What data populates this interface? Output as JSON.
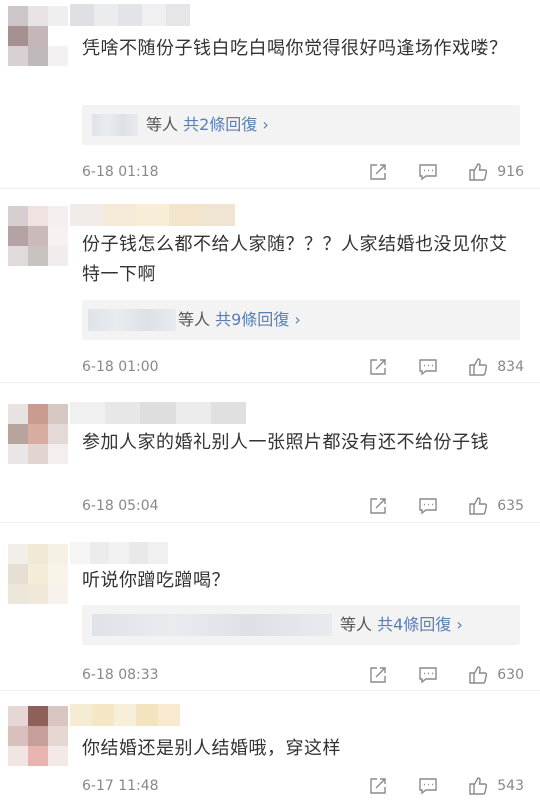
{
  "comments": [
    {
      "text": "凭啥不随份子钱白吃白喝你觉得很好吗逢场作戏喽？",
      "reply": {
        "who": "等人",
        "link": "共2條回復 ›"
      },
      "time": "6-18 01:18",
      "likes": "916",
      "avatar_colors": [
        "#cdc6c8",
        "#e8e4e6",
        "#f0eeef",
        "#a68f8f",
        "#c5b6b8",
        "#ffffff",
        "#d8d0d3",
        "#bfb9bb",
        "#f3f1f2"
      ],
      "name_colors": [
        "#dfe0e4",
        "#ebeced",
        "#e3e4e7",
        "#f0f0f2",
        "#e6e6e9"
      ]
    },
    {
      "text": "份子钱怎么都不给人家随？？？人家结婚也没见你艾特一下啊",
      "reply": {
        "who": "等人",
        "link": "共9條回復 ›"
      },
      "time": "6-18 01:00",
      "likes": "834",
      "avatar_colors": [
        "#d7cfcf",
        "#efe2e1",
        "#f4eeee",
        "#b3a3a4",
        "#cbbab9",
        "#f6f2f1",
        "#e1dada",
        "#c8c2c1",
        "#f2eded"
      ],
      "name_colors": [
        "#f2ece8",
        "#f5e9d8",
        "#f8edd6",
        "#f3e4cc",
        "#f0e5d3"
      ]
    },
    {
      "text": "参加人家的婚礼别人一张照片都没有还不给份子钱",
      "reply": null,
      "time": "6-18 05:04",
      "likes": "635",
      "avatar_colors": [
        "#e8e2e1",
        "#c99c8f",
        "#d8c8c4",
        "#b8a49f",
        "#d8ada0",
        "#e3dad7",
        "#eae6e5",
        "#e2d4d0",
        "#f2efee"
      ],
      "name_colors": [
        "#f0f0f0",
        "#e7e7e7",
        "#dedede",
        "#ececec",
        "#e0e0e0"
      ]
    },
    {
      "text": "听说你蹭吃蹭喝？",
      "reply": {
        "who": "等人",
        "link": "共4條回復 ›"
      },
      "time": "6-18 08:33",
      "likes": "630",
      "avatar_colors": [
        "#f2efe8",
        "#f1e9d6",
        "#f6f1e5",
        "#e7dfd3",
        "#f5ecd8",
        "#f8f4ea",
        "#ece6db",
        "#f0e8d8",
        "#f7f3ec"
      ],
      "name_colors": [
        "#f5f5f5",
        "#ececec",
        "#f2f2f2",
        "#e9e9e9",
        "#f0f0f0"
      ]
    },
    {
      "text": "你结婚还是别人结婚哦，穿这样",
      "reply": null,
      "time": "6-17 11:48",
      "likes": "543",
      "avatar_colors": [
        "#e6d7d6",
        "#8f5f59",
        "#d9c5c2",
        "#d9c0bd",
        "#c69f9a",
        "#e7d7d3",
        "#f0e5e3",
        "#e8b4b0",
        "#f3e9e7"
      ],
      "name_colors": [
        "#f6ecd3",
        "#f5e6c6",
        "#f8efda",
        "#f3e3bf",
        "#f7ead0"
      ]
    }
  ],
  "icons": {
    "share": "share-icon",
    "comment": "comment-icon",
    "like": "thumbs-up-icon"
  },
  "colors": {
    "link": "#5a7fb0",
    "text": "#333333",
    "meta": "#888888",
    "reply_bg": "#f3f3f3"
  }
}
